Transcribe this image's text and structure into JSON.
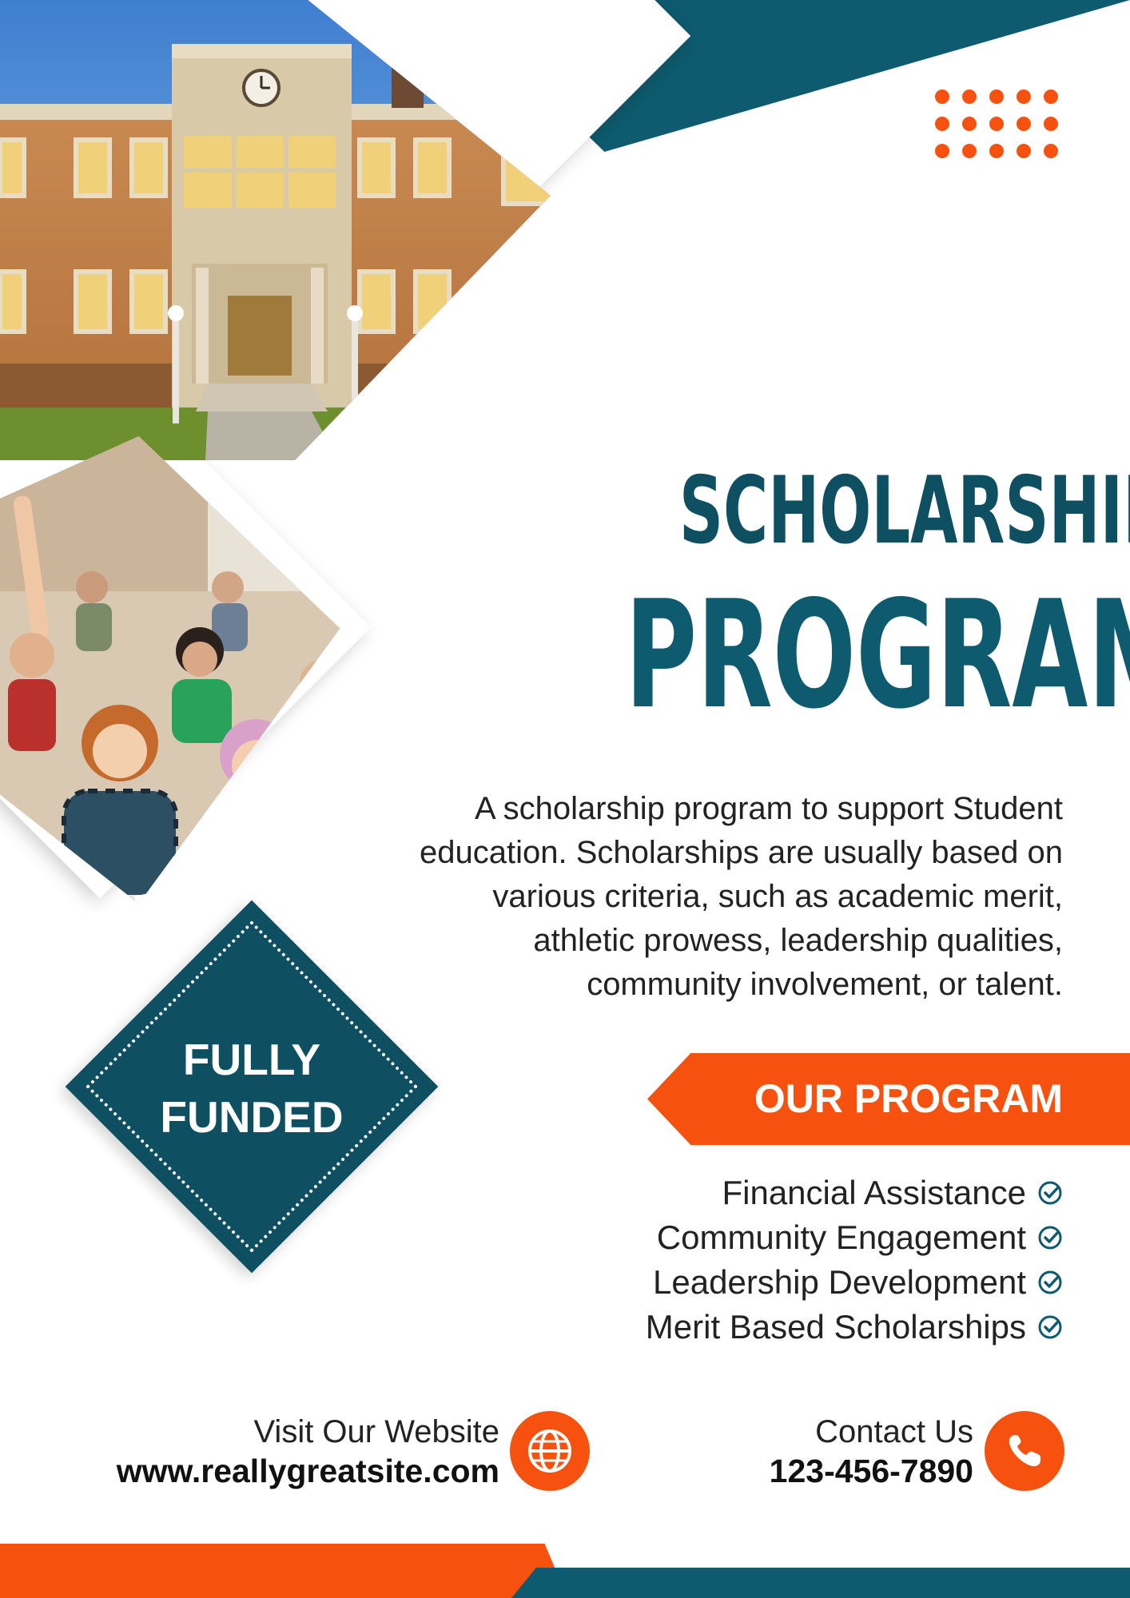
{
  "colors": {
    "teal": "#0e5a6e",
    "dark_teal": "#0e4f62",
    "orange": "#f75110",
    "text": "#222222"
  },
  "images": {
    "building_photo": "school-building-photo",
    "classroom_photo": "students-classroom-photo"
  },
  "badge": {
    "line1": "FULLY",
    "line2": "FUNDED"
  },
  "headline": {
    "line1": "SCHOLARSHIP",
    "line2": "PROGRAM"
  },
  "description": {
    "lines": [
      "A scholarship program to support Student",
      "education. Scholarships are usually based on",
      "various criteria, such as academic merit,",
      "athletic prowess, leadership qualities,",
      "community involvement, or talent."
    ]
  },
  "program": {
    "heading": "OUR PROGRAM",
    "items": [
      "Financial Assistance",
      "Community Engagement",
      "Leadership Development",
      "Merit Based Scholarships"
    ],
    "item_icon": "check-circle-icon"
  },
  "contact": {
    "website_caption": "Visit Our Website",
    "website_url": "www.reallygreatsite.com",
    "website_icon": "globe-icon",
    "phone_caption": "Contact Us",
    "phone_number": "123-456-7890",
    "phone_icon": "phone-icon"
  }
}
